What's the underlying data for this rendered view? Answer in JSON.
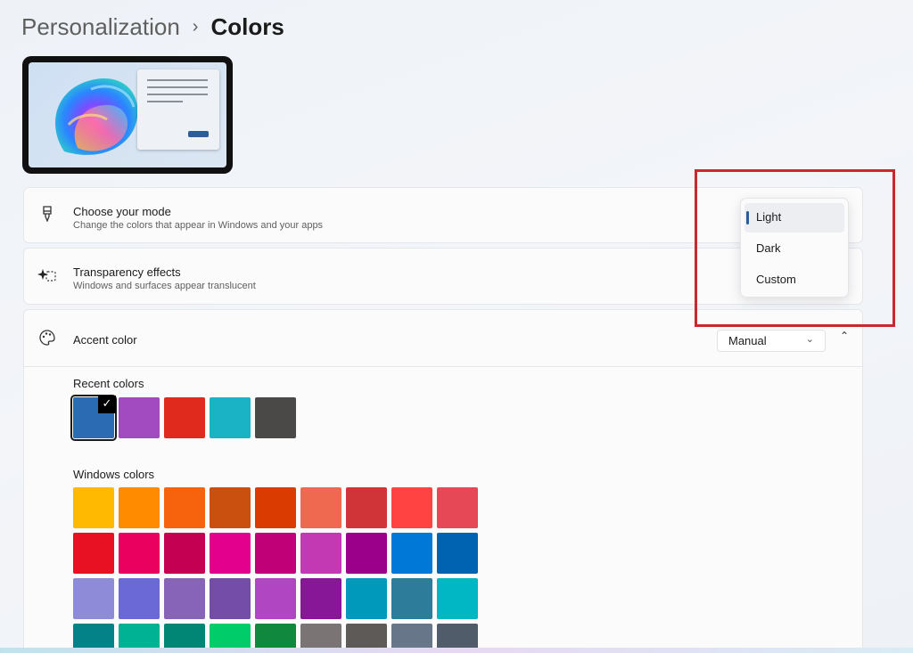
{
  "breadcrumb": {
    "parent": "Personalization",
    "separator": "›",
    "current": "Colors"
  },
  "mode": {
    "title": "Choose your mode",
    "subtitle": "Change the colors that appear in Windows and your apps",
    "icon": "brush-icon",
    "menu": {
      "options": [
        "Light",
        "Dark",
        "Custom"
      ],
      "selected": "Light"
    }
  },
  "transparency": {
    "title": "Transparency effects",
    "subtitle": "Windows and surfaces appear translucent",
    "icon": "transparency-sparkle-icon"
  },
  "accent": {
    "title": "Accent color",
    "icon": "palette-icon",
    "select_value": "Manual",
    "chevron": "⌄",
    "collapse": "⌃",
    "recent_label": "Recent colors",
    "recent_colors": [
      "#2a6bb3",
      "#a24bc1",
      "#e02a1e",
      "#1ab3c6",
      "#4b4948"
    ],
    "selected_recent_index": 0,
    "windows_label": "Windows colors",
    "windows_colors": [
      "#ffb900",
      "#ff8c00",
      "#f7630c",
      "#ca5010",
      "#da3b01",
      "#ef6950",
      "#d13438",
      "#ff4343",
      "#e74856",
      "#e81123",
      "#ea005e",
      "#c30052",
      "#e3008c",
      "#bf0077",
      "#c239b3",
      "#9a0089",
      "#0078d7",
      "#0063b1",
      "#8e8cd8",
      "#6b69d6",
      "#8764b8",
      "#744da9",
      "#b146c2",
      "#881798",
      "#0099bc",
      "#2d7d9a",
      "#00b7c3",
      "#038387",
      "#00b294",
      "#018574",
      "#00cc6a",
      "#10893e",
      "#7a7574",
      "#5d5a58",
      "#68768a",
      "#515c6b"
    ]
  },
  "colors": {
    "highlight": "#c8282e",
    "accent_indicator": "#2b5d9b"
  }
}
